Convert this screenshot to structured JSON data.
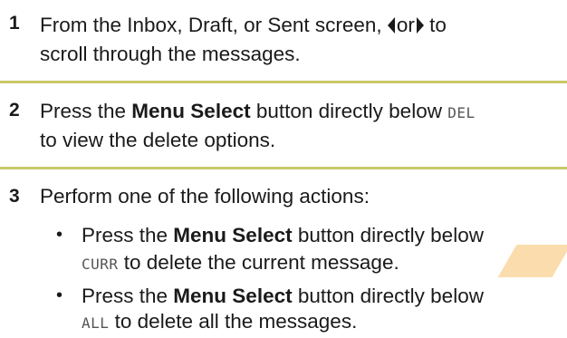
{
  "step1": {
    "number": "1",
    "line1_a": "From the Inbox, Draft, or Sent screen, ",
    "left_arrow_icon": "left-triangle-arrow",
    "or_word": "or",
    "right_arrow_icon": "right-triangle-arrow",
    "line1_b": " to",
    "line2": "scroll through the messages."
  },
  "step2": {
    "number": "2",
    "line1_a": "Press the ",
    "line1_bold": "Menu Select",
    "line1_b": " button directly below ",
    "line1_lcd": "DEL",
    "line2": "to view the delete options."
  },
  "step3": {
    "number": "3",
    "line1": "Perform one of the following actions:",
    "bullets": [
      {
        "bullet": "•",
        "line1_a": "Press the ",
        "line1_bold": "Menu Select",
        "line1_b": " button directly below",
        "line2_lcd": "CURR",
        "line2_b": " to delete the current message."
      },
      {
        "bullet": "•",
        "line1_a": "Press the ",
        "line1_bold": "Menu Select",
        "line1_b": " button directly below",
        "line2_lcd": "ALL",
        "line2_b": " to delete all the messages."
      }
    ]
  },
  "colors": {
    "divider": "#c8c96a",
    "text": "#1a1a1a",
    "watermark": "#f9ce8a"
  }
}
